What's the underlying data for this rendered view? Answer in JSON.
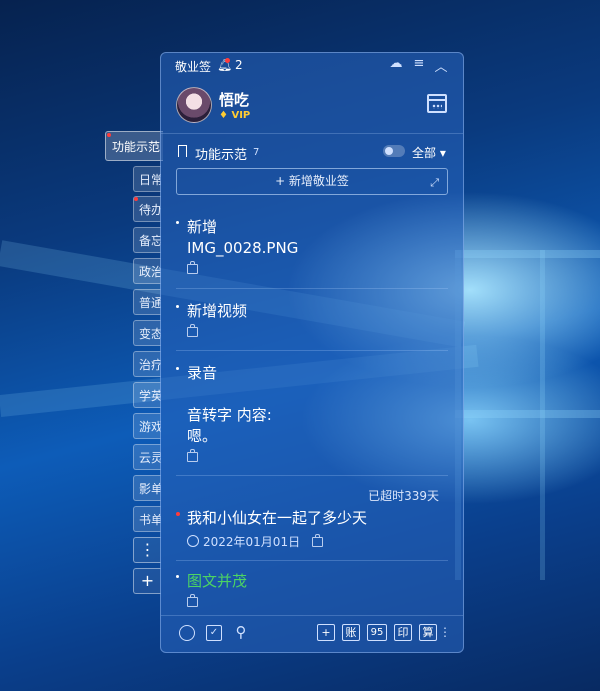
{
  "side_tabs": {
    "main_label": "功能示范",
    "items": [
      "日常",
      "待办",
      "备忘",
      "政治",
      "普通",
      "变态",
      "治疗",
      "学英",
      "游戏",
      "云灵",
      "影单",
      "书单"
    ],
    "more_label": "⋮",
    "add_label": "+"
  },
  "panel": {
    "title": "敬业签",
    "notification_count": "2",
    "user": {
      "name": "悟吃",
      "badge": "VIP"
    },
    "category": {
      "label": "功能示范",
      "count": "7",
      "filter": "全部"
    },
    "add_button": "+ 新增敬业签",
    "notes": [
      {
        "text": "新增\nIMG_0028.PNG"
      },
      {
        "text": "新增视频"
      },
      {
        "text": "录音\n\n音转字 内容:\n嗯。"
      },
      {
        "overdue": "已超时339天",
        "text": "我和小仙女在一起了多少天",
        "date": "2022年01月01日"
      },
      {
        "text": "图文并茂"
      }
    ],
    "bottom_tools": [
      "+",
      "账",
      "95",
      "印",
      "算"
    ]
  },
  "colors": {
    "accent_red": "#ff3b3b",
    "vip_gold": "#ffcc33",
    "green_text": "#4cd463"
  }
}
